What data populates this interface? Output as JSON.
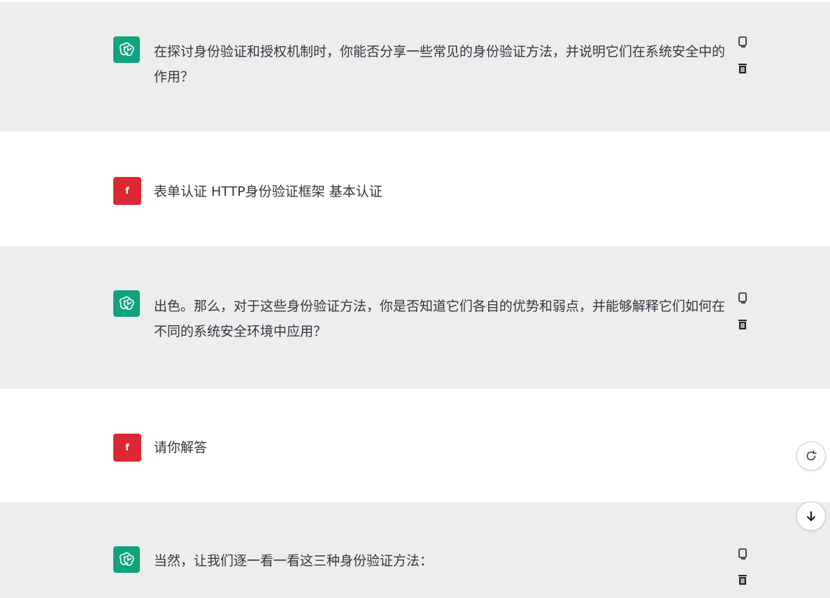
{
  "messages": [
    {
      "role": "assistant",
      "text": "在探讨身份验证和授权机制时，你能否分享一些常见的身份验证方法，并说明它们在系统安全中的作用？"
    },
    {
      "role": "user",
      "avatar_letter": "f",
      "text": "表单认证 HTTP身份验证框架 基本认证"
    },
    {
      "role": "assistant",
      "text": "出色。那么，对于这些身份验证方法，你是否知道它们各自的优势和弱点，并能够解释它们如何在不同的系统安全环境中应用？"
    },
    {
      "role": "user",
      "avatar_letter": "f",
      "text": "请你解答"
    },
    {
      "role": "assistant",
      "text": "当然，让我们逐一看一看这三种身份验证方法："
    }
  ],
  "icons": {
    "assistant_avatar": "openai-logo-icon",
    "copy": "copy-icon",
    "delete": "trash-icon",
    "regenerate": "refresh-icon",
    "scroll_down": "arrow-down-icon"
  },
  "colors": {
    "assistant_bg": "#ededed",
    "user_bg": "#ffffff",
    "assistant_avatar_bg": "#10a37f",
    "user_avatar_bg": "#dc2830",
    "text": "#343541"
  }
}
